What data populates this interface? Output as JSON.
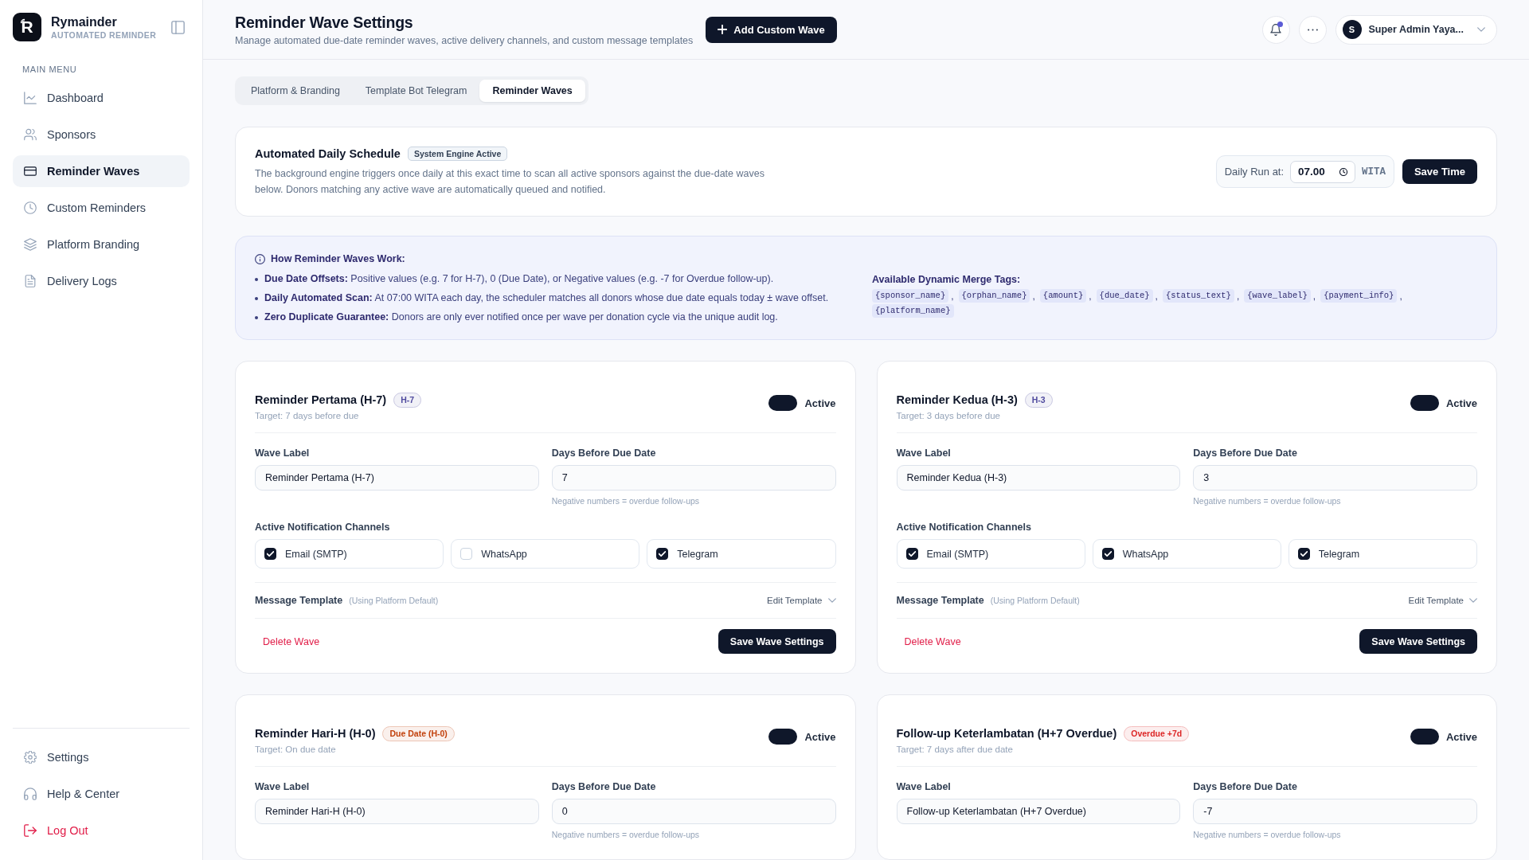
{
  "sidebar": {
    "logo_letter": "R",
    "brand": "Rymainder",
    "tagline": "AUTOMATED REMINDER",
    "section_label": "MAIN MENU",
    "items": [
      {
        "label": "Dashboard",
        "selected": false
      },
      {
        "label": "Sponsors",
        "selected": false
      },
      {
        "label": "Reminder Waves",
        "selected": true
      },
      {
        "label": "Custom Reminders",
        "selected": false
      },
      {
        "label": "Platform Branding",
        "selected": false
      },
      {
        "label": "Delivery Logs",
        "selected": false
      }
    ],
    "footer_items": [
      {
        "label": "Settings",
        "kind": "normal"
      },
      {
        "label": "Help & Center",
        "kind": "normal"
      },
      {
        "label": "Log Out",
        "kind": "danger"
      }
    ]
  },
  "header": {
    "title": "Reminder Wave Settings",
    "subtitle": "Manage automated due-date reminder waves, active delivery channels, and custom message templates",
    "add_button": "Add Custom Wave",
    "unread": true,
    "user": {
      "initial": "S",
      "name": "Super Admin Yaya..."
    }
  },
  "tabs": [
    {
      "label": "Platform & Branding",
      "selected": false
    },
    {
      "label": "Template Bot Telegram",
      "selected": false
    },
    {
      "label": "Reminder Waves",
      "selected": true
    }
  ],
  "schedule": {
    "title": "Automated Daily Schedule",
    "badge": "System Engine Active",
    "description": "The background engine triggers once daily at this exact time to scan all active sponsors against the due-date waves below. Donors matching any active wave are automatically queued and notified.",
    "run_label": "Daily Run at:",
    "time": "07.00",
    "timezone": "WITA",
    "save_button": "Save Time"
  },
  "info": {
    "title": "How Reminder Waves Work:",
    "points": [
      "**Due Date Offsets:** Positive values (e.g. 7 for H-7), 0 (Due Date), or Negative values (e.g. -7 for Overdue follow-up).",
      "**Daily Automated Scan:** At 07:00 WITA each day, the scheduler matches all donors whose due date equals today ± wave offset.",
      "**Zero Duplicate Guarantee:** Donors are only ever notified once per wave per donation cycle via the unique audit log."
    ],
    "tags_title": "Available Dynamic Merge Tags:",
    "tags": [
      "{sponsor_name}",
      "{orphan_name}",
      "{amount}",
      "{due_date}",
      "{status_text}",
      "{wave_label}",
      "{payment_info}",
      "{platform_name}"
    ],
    "tag_separator": ","
  },
  "waves": [
    {
      "title": "Reminder Pertama (H-7)",
      "badge": {
        "text": "H-7",
        "color": "#4f4a9e"
      },
      "target": "Target: 7 days before due",
      "on": true,
      "toggle_label": "Active",
      "label_field": {
        "label": "Wave Label",
        "value": "Reminder Pertama (H-7)"
      },
      "days_field": {
        "label": "Days Before Due Date",
        "value": "7",
        "hint": "Negative numbers = overdue follow-ups"
      },
      "channels_heading": "Active Notification Channels",
      "channels": [
        {
          "label": "Email (SMTP)",
          "checked": true
        },
        {
          "label": "WhatsApp",
          "checked": false
        },
        {
          "label": "Telegram",
          "checked": true
        }
      ],
      "template": {
        "label": "Message Template",
        "note": "(Using Platform Default)",
        "edit": "Edit Template"
      },
      "delete_button": "Delete Wave",
      "save_button": "Save Wave Settings"
    },
    {
      "title": "Reminder Kedua (H-3)",
      "badge": {
        "text": "H-3",
        "color": "#4f4a9e"
      },
      "target": "Target: 3 days before due",
      "on": true,
      "toggle_label": "Active",
      "label_field": {
        "label": "Wave Label",
        "value": "Reminder Kedua (H-3)"
      },
      "days_field": {
        "label": "Days Before Due Date",
        "value": "3",
        "hint": "Negative numbers = overdue follow-ups"
      },
      "channels_heading": "Active Notification Channels",
      "channels": [
        {
          "label": "Email (SMTP)",
          "checked": true
        },
        {
          "label": "WhatsApp",
          "checked": true
        },
        {
          "label": "Telegram",
          "checked": true
        }
      ],
      "template": {
        "label": "Message Template",
        "note": "(Using Platform Default)",
        "edit": "Edit Template"
      },
      "delete_button": "Delete Wave",
      "save_button": "Save Wave Settings"
    },
    {
      "title": "Reminder Hari-H (H-0)",
      "badge": {
        "text": "Due Date (H-0)",
        "color": "#c2410c"
      },
      "target": "Target: On due date",
      "on": true,
      "toggle_label": "Active",
      "label_field": {
        "label": "Wave Label",
        "value": "Reminder Hari-H (H-0)"
      },
      "days_field": {
        "label": "Days Before Due Date",
        "value": "0",
        "hint": "Negative numbers = overdue follow-ups"
      }
    },
    {
      "title": "Follow-up Keterlambatan (H+7 Overdue)",
      "badge": {
        "text": "Overdue +7d",
        "color": "#dc2626"
      },
      "target": "Target: 7 days after due date",
      "on": true,
      "toggle_label": "Active",
      "label_field": {
        "label": "Wave Label",
        "value": "Follow-up Keterlambatan (H+7 Overdue)"
      },
      "days_field": {
        "label": "Days Before Due Date",
        "value": "-7",
        "hint": "Negative numbers = overdue follow-ups"
      }
    }
  ]
}
